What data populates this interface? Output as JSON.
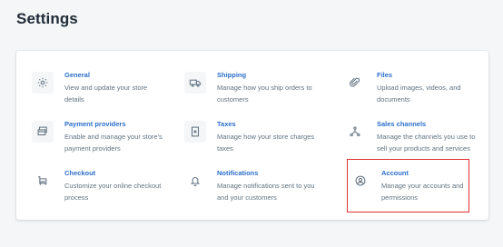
{
  "page": {
    "title": "Settings"
  },
  "settings": [
    {
      "key": "general",
      "title": "General",
      "desc_lines": [
        "View and update your store",
        "details"
      ],
      "icon": "gear-icon"
    },
    {
      "key": "shipping",
      "title": "Shipping",
      "desc_lines": [
        "Manage how you ship orders to",
        "customers"
      ],
      "icon": "truck-icon"
    },
    {
      "key": "files",
      "title": "Files",
      "desc_lines": [
        "Upload images, videos, and",
        "documents"
      ],
      "icon": "paperclip-icon"
    },
    {
      "key": "payment-providers",
      "title": "Payment providers",
      "desc_lines": [
        "Enable and manage your store's",
        "payment providers"
      ],
      "icon": "credit-card-icon"
    },
    {
      "key": "taxes",
      "title": "Taxes",
      "desc_lines": [
        "Manage how your store charges",
        "taxes"
      ],
      "icon": "receipt-icon"
    },
    {
      "key": "sales-channels",
      "title": "Sales channels",
      "desc_lines": [
        "Manage the channels you use to",
        "sell your products and services"
      ],
      "icon": "channels-icon"
    },
    {
      "key": "checkout",
      "title": "Checkout",
      "desc_lines": [
        "Customize your online checkout",
        "process"
      ],
      "icon": "cart-icon"
    },
    {
      "key": "notifications",
      "title": "Notifications",
      "desc_lines": [
        "Manage notifications sent to you",
        "and your customers"
      ],
      "icon": "bell-icon"
    },
    {
      "key": "account",
      "title": "Account",
      "desc_lines": [
        "Manage your accounts and",
        "permissions"
      ],
      "icon": "user-circle-icon"
    }
  ],
  "colors": {
    "link": "#2c6ecb",
    "muted": "#637381",
    "highlight": "#e02f2f",
    "icon_bg": "#f4f6f8"
  }
}
